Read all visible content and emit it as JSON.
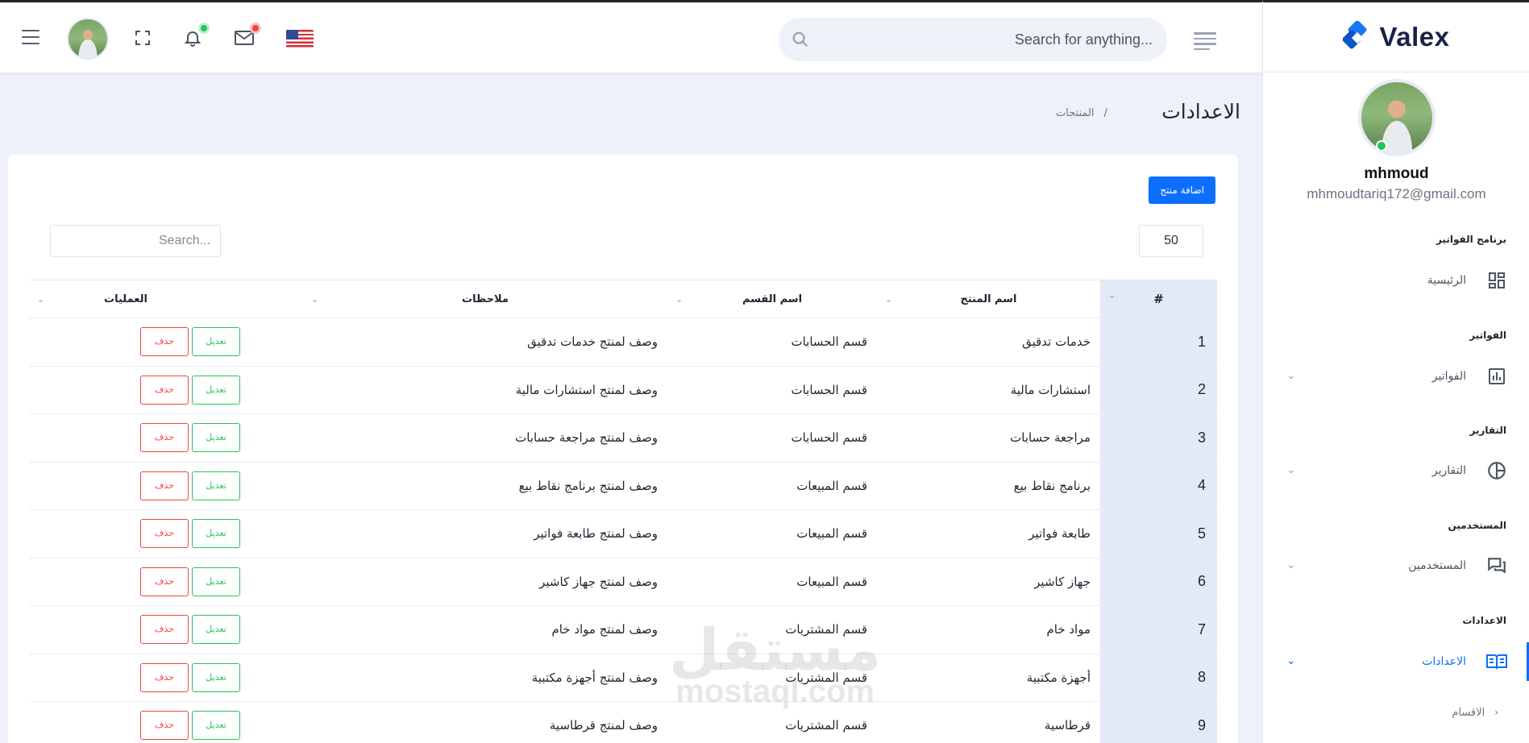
{
  "brand": {
    "name": "Valex"
  },
  "header": {
    "search_placeholder": "Search for anything...",
    "icons": [
      "menu-icon",
      "fullscreen-icon",
      "bell-icon",
      "mail-icon",
      "us-flag-icon",
      "list-icon",
      "search-icon"
    ],
    "colors": {
      "notification_dot": "#22c55e",
      "mail_dot": "#ef4444"
    }
  },
  "profile": {
    "name": "mhmoud",
    "email": "mhmoudtariq172@gmail.com",
    "status_color": "#22c55e"
  },
  "sidebar": {
    "sections": [
      {
        "title": "برنامج الفواتير",
        "item": {
          "label": "الرئيسية",
          "icon": "dashboard-icon",
          "has_chevron": false
        }
      },
      {
        "title": "الفواتير",
        "item": {
          "label": "الفواتير",
          "icon": "bar-chart-icon",
          "has_chevron": true
        }
      },
      {
        "title": "التقارير",
        "item": {
          "label": "التقارير",
          "icon": "pie-chart-icon",
          "has_chevron": true
        }
      },
      {
        "title": "المستخدمين",
        "item": {
          "label": "المستخدمين",
          "icon": "chat-icon",
          "has_chevron": true
        }
      },
      {
        "title": "الاعدادات",
        "item": {
          "label": "الاعدادات",
          "icon": "book-icon",
          "has_chevron": true,
          "active": true
        }
      }
    ],
    "sub_items": [
      {
        "label": "الاقسام"
      }
    ],
    "accent_color": "#0d6efd"
  },
  "page": {
    "title": "الاعدادات",
    "breadcrumb_sep": "/",
    "breadcrumb_current": "المنتجات"
  },
  "card": {
    "add_button": "اضافة منتج",
    "page_length": "50",
    "search_placeholder": "Search...",
    "columns": [
      "#",
      "اسم المنتج",
      "اسم القسم",
      "ملاحظات",
      "العمليات"
    ],
    "edit_label": "تعديل",
    "delete_label": "حذف",
    "rows": [
      {
        "num": "1",
        "product": "خدمات تدقيق",
        "section": "قسم الحسابات",
        "notes": "وصف لمنتج خدمات تدقيق"
      },
      {
        "num": "2",
        "product": "استشارات مالية",
        "section": "قسم الحسابات",
        "notes": "وصف لمنتج استشارات مالية"
      },
      {
        "num": "3",
        "product": "مراجعة حسابات",
        "section": "قسم الحسابات",
        "notes": "وصف لمنتج مراجعة حسابات"
      },
      {
        "num": "4",
        "product": "برنامج نقاط بيع",
        "section": "قسم المبيعات",
        "notes": "وصف لمنتج برنامج نقاط بيع"
      },
      {
        "num": "5",
        "product": "طابعة فواتير",
        "section": "قسم المبيعات",
        "notes": "وصف لمنتج طابعة فواتير"
      },
      {
        "num": "6",
        "product": "جهاز كاشير",
        "section": "قسم المبيعات",
        "notes": "وصف لمنتج جهاز كاشير"
      },
      {
        "num": "7",
        "product": "مواد خام",
        "section": "قسم المشتريات",
        "notes": "وصف لمنتج مواد خام"
      },
      {
        "num": "8",
        "product": "أجهزة مكتبية",
        "section": "قسم المشتريات",
        "notes": "وصف لمنتج أجهزة مكتبية"
      },
      {
        "num": "9",
        "product": "قرطاسية",
        "section": "قسم المشتريات",
        "notes": "وصف لمنتج قرطاسية"
      }
    ]
  },
  "watermark": {
    "arabic": "مستقل",
    "latin": "mostaql.com"
  }
}
